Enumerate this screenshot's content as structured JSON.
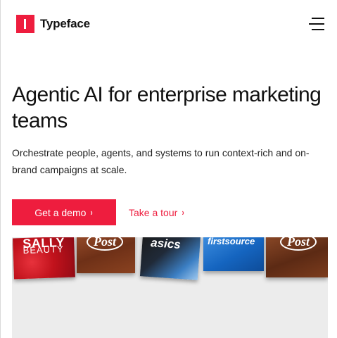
{
  "brand": {
    "name": "Typeface",
    "accent_color": "#ee1d3e"
  },
  "header": {
    "menu_icon": "hamburger-menu-icon"
  },
  "hero": {
    "title": "Agentic AI for enterprise marketing teams",
    "subtitle": "Orchestrate people, agents, and systems to run context-rich and on-brand campaigns at scale."
  },
  "cta": {
    "demo_label": "Get a demo",
    "tour_label": "Take a tour",
    "chevron": "›"
  },
  "gallery": {
    "cards": [
      {
        "brand_line1": "SALLY",
        "brand_line2": "BEAUTY"
      },
      {
        "brand": "Post"
      },
      {
        "brand": "asics"
      },
      {
        "brand": "firstsource"
      },
      {
        "brand": "Post"
      }
    ]
  }
}
